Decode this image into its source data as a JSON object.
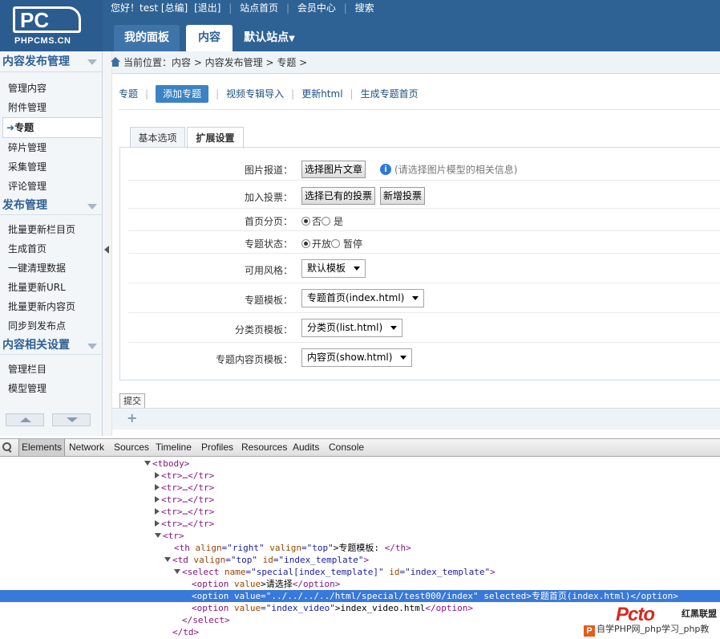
{
  "logo": {
    "mark": "PC",
    "brand": "PHPCMS.CN"
  },
  "toplinks": {
    "greeting": "您好！test [总编]",
    "logout": "[退出]",
    "home": "站点首页",
    "member": "会员中心",
    "search": "搜索"
  },
  "mainnav": {
    "panel": "我的面板",
    "content": "内容",
    "site": "默认站点"
  },
  "sidebar": {
    "groups": [
      {
        "title": "内容发布管理",
        "items": [
          "管理内容",
          "附件管理",
          "专题",
          "碎片管理",
          "采集管理",
          "评论管理"
        ]
      },
      {
        "title": "发布管理",
        "items": [
          "批量更新栏目页",
          "生成首页",
          "一键清理数据",
          "批量更新URL",
          "批量更新内容页",
          "同步到发布点"
        ]
      },
      {
        "title": "内容相关设置",
        "items": [
          "管理栏目",
          "模型管理"
        ]
      }
    ]
  },
  "breadcrumb": "当前位置：内容 > 内容发布管理 > 专题 >",
  "subnav": {
    "topic": "专题",
    "add": "添加专题",
    "video": "视频专辑导入",
    "update": "更新html",
    "gen": "生成专题首页"
  },
  "tabs": {
    "basic": "基本选项",
    "ext": "扩展设置"
  },
  "form": {
    "pic_label": "图片报道：",
    "pic_btn": "选择图片文章",
    "pic_hint": "(请选择图片模型的相关信息)",
    "info": "i",
    "vote_label": "加入投票：",
    "vote_btn1": "选择已有的投票",
    "vote_btn2": "新增投票",
    "paging_label": "首页分页：",
    "paging_no": "否",
    "paging_yes": "是",
    "status_label": "专题状态：",
    "status_on": "开放",
    "status_off": "暂停",
    "style_label": "可用风格：",
    "style_val": "默认模板",
    "tpl_label": "专题模板：",
    "tpl_val": "专题首页(index.html)",
    "list_label": "分类页模板：",
    "list_val": "分类页(list.html)",
    "show_label": "专题内容页模板：",
    "show_val": "内容页(show.html)",
    "submit": "提交"
  },
  "devtools": {
    "tabs": [
      "Elements",
      "Network",
      "Sources",
      "Timeline",
      "Profiles",
      "Resources",
      "Audits",
      "Console"
    ]
  },
  "dom": {
    "l1": "<tbody>",
    "l2": "<tr>…</tr>",
    "l3": "<tr>…</tr>",
    "l4": "<tr>…</tr>",
    "l5": "<tr>…</tr>",
    "l6": "<tr>…</tr>",
    "l7": "<tr>",
    "l8a": "<th ",
    "l8b": "align",
    "l8c": "=\"right\" ",
    "l8d": "valign",
    "l8e": "=\"top\"",
    "l8f": ">专题模板: ",
    "l8g": "</th>",
    "l9a": "<td ",
    "l9b": "valign",
    "l9c": "=\"top\" ",
    "l9d": "id",
    "l9e": "=\"index_template\"",
    "l9f": ">",
    "l10a": "<select ",
    "l10b": "name",
    "l10c": "=\"special[index_template]\" ",
    "l10d": "id",
    "l10e": "=\"index_template\"",
    "l10f": ">",
    "l11a": "<option ",
    "l11b": "value",
    "l11c": ">请选择",
    "l11d": "</option>",
    "l12": "<option value=\"../../../../html/special/test000/index\" selected>专题首页(index.html)</option>",
    "l13a": "<option ",
    "l13b": "value",
    "l13c": "=\"index_video\"",
    "l13d": ">index_video.html",
    "l13e": "</option>",
    "l14": "</select>",
    "l15": "</td>"
  },
  "watermark": {
    "logo": "Pcto",
    "brand": "红黑联盟",
    "p": "P",
    "text": "自学PHP网_php学习_php教"
  }
}
